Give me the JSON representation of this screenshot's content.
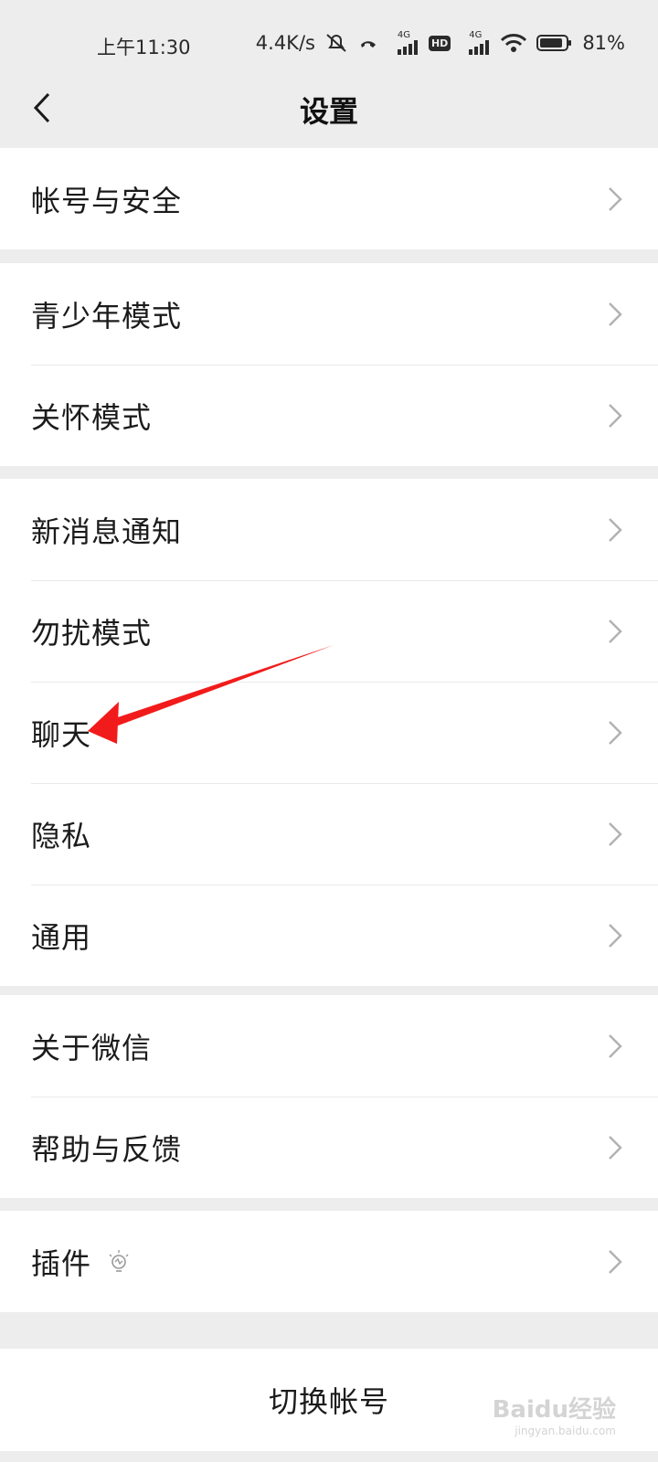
{
  "status_bar": {
    "time": "上午11:30",
    "speed": "4.4K/s",
    "net1": "4G",
    "net2": "4G",
    "hd": "HD",
    "battery": "81%"
  },
  "nav": {
    "title": "设置"
  },
  "groups": [
    {
      "items": [
        "帐号与安全"
      ]
    },
    {
      "items": [
        "青少年模式",
        "关怀模式"
      ]
    },
    {
      "items": [
        "新消息通知",
        "勿扰模式",
        "聊天",
        "隐私",
        "通用"
      ]
    },
    {
      "items": [
        "关于微信",
        "帮助与反馈"
      ]
    },
    {
      "items": [
        "插件"
      ]
    }
  ],
  "switch_account": "切换帐号",
  "watermark": {
    "brand": "Baidu经验",
    "url": "jingyan.baidu.com"
  },
  "colors": {
    "annotation_arrow": "#f21b1b",
    "chevron": "#b2b2b2"
  }
}
